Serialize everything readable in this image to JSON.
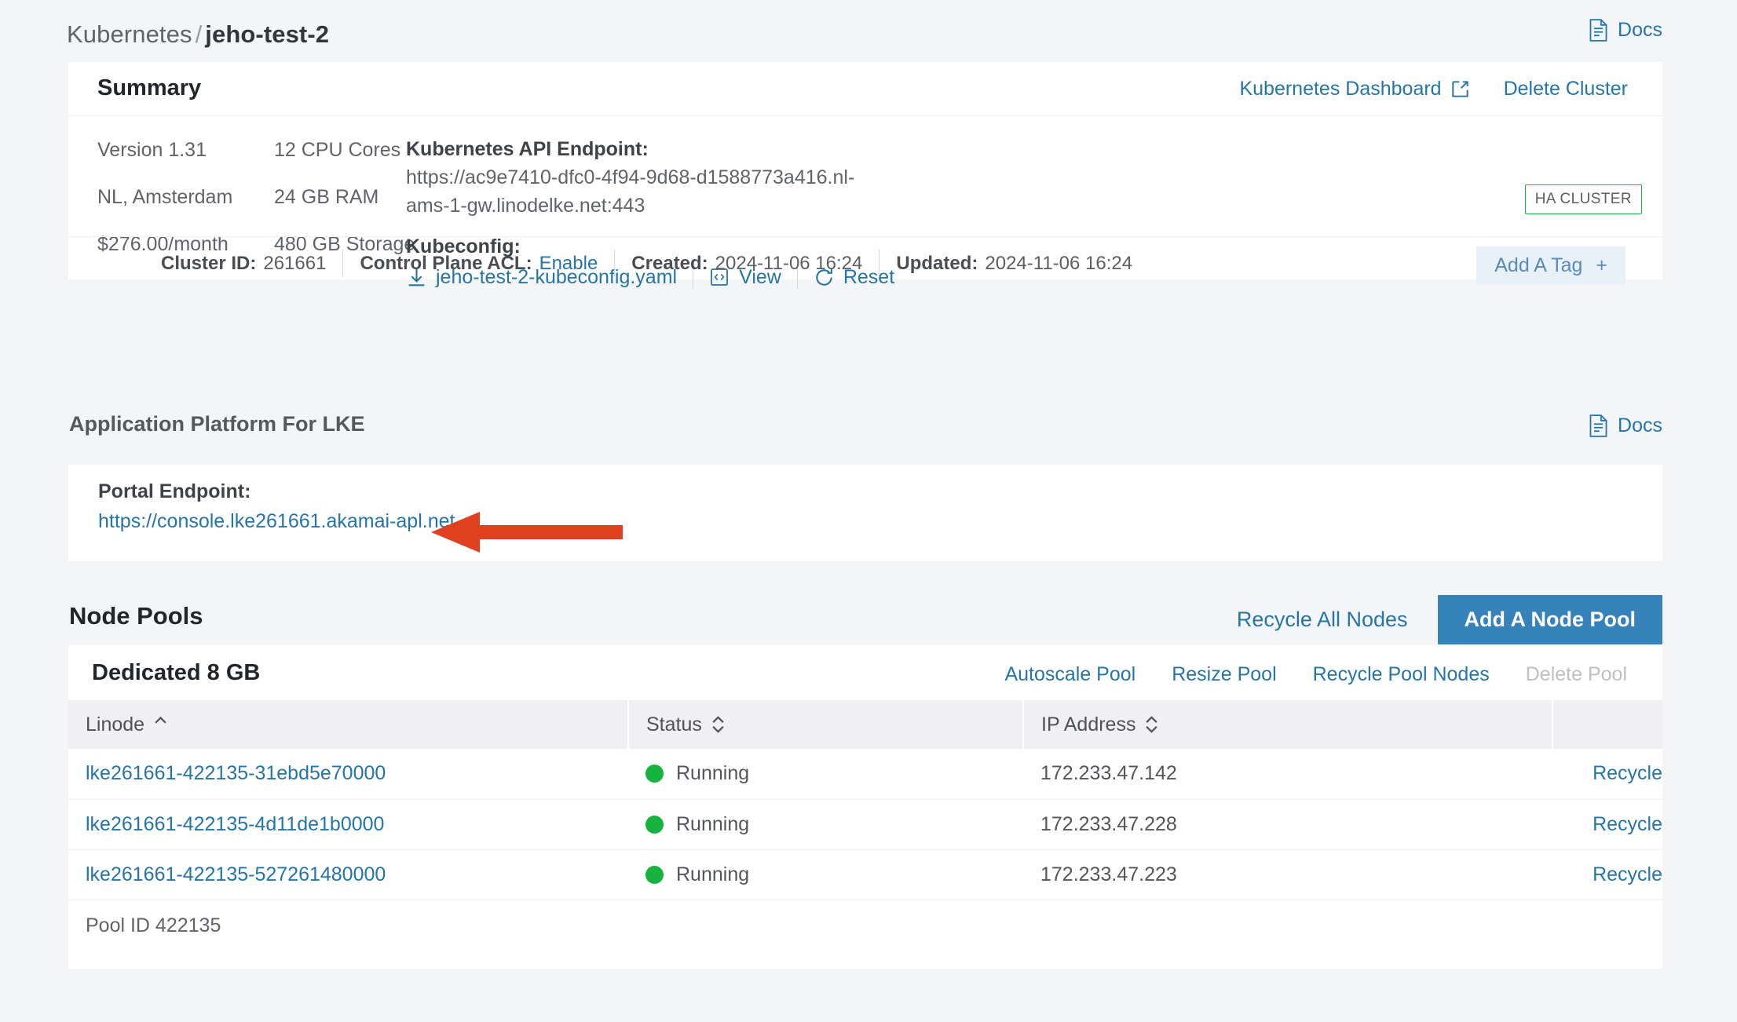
{
  "breadcrumb": {
    "parent": "Kubernetes",
    "separator": "/",
    "current": "jeho-test-2"
  },
  "top_docs": {
    "label": "Docs",
    "icon": "document-icon"
  },
  "summary": {
    "title": "Summary",
    "actions": {
      "dashboard": "Kubernetes Dashboard",
      "delete_cluster": "Delete Cluster"
    },
    "stats_left": [
      "Version 1.31",
      "NL, Amsterdam",
      "$276.00/month"
    ],
    "stats_mid": [
      "12 CPU Cores",
      "24 GB RAM",
      "480 GB Storage"
    ],
    "api_endpoint_label": "Kubernetes API Endpoint:",
    "api_endpoint_value": "https://ac9e7410-dfc0-4f94-9d68-d1588773a416.nl-ams-1-gw.linodelke.net:443",
    "kubeconfig_label": "Kubeconfig:",
    "kubeconfig_file": "jeho-test-2-kubeconfig.yaml",
    "kubeconfig_view": "View",
    "kubeconfig_reset": "Reset",
    "ha_badge": "HA CLUSTER",
    "meta": {
      "cluster_id_key": "Cluster ID:",
      "cluster_id_val": "261661",
      "acl_key": "Control Plane ACL:",
      "acl_link": "Enable",
      "created_key": "Created:",
      "created_val": "2024-11-06 16:24",
      "updated_key": "Updated:",
      "updated_val": "2024-11-06 16:24"
    },
    "add_tag": "Add A Tag",
    "add_tag_plus": "+"
  },
  "apl": {
    "section_title": "Application Platform For LKE",
    "docs_label": "Docs",
    "portal_label": "Portal Endpoint:",
    "portal_url": "https://console.lke261661.akamai-apl.net"
  },
  "node_pools": {
    "title": "Node Pools",
    "recycle_all": "Recycle All Nodes",
    "add_node_pool": "Add A Node Pool",
    "pool_name": "Dedicated 8 GB",
    "pool_links": {
      "autoscale": "Autoscale Pool",
      "resize": "Resize Pool",
      "recycle_nodes": "Recycle Pool Nodes",
      "delete": "Delete Pool"
    },
    "columns": [
      "Linode",
      "Status",
      "IP Address",
      ""
    ],
    "rows": [
      {
        "linode": "lke261661-422135-31ebd5e70000",
        "status": "Running",
        "ip": "172.233.47.142",
        "action": "Recycle"
      },
      {
        "linode": "lke261661-422135-4d11de1b0000",
        "status": "Running",
        "ip": "172.233.47.228",
        "action": "Recycle"
      },
      {
        "linode": "lke261661-422135-527261480000",
        "status": "Running",
        "ip": "172.233.47.223",
        "action": "Recycle"
      }
    ],
    "pool_id_text": "Pool ID 422135"
  },
  "colors": {
    "link": "#2575a7",
    "primary_button": "#3682ba",
    "status_running": "#17b33f",
    "annotation_arrow": "#e0401f",
    "page_background": "#f4f5f7"
  }
}
